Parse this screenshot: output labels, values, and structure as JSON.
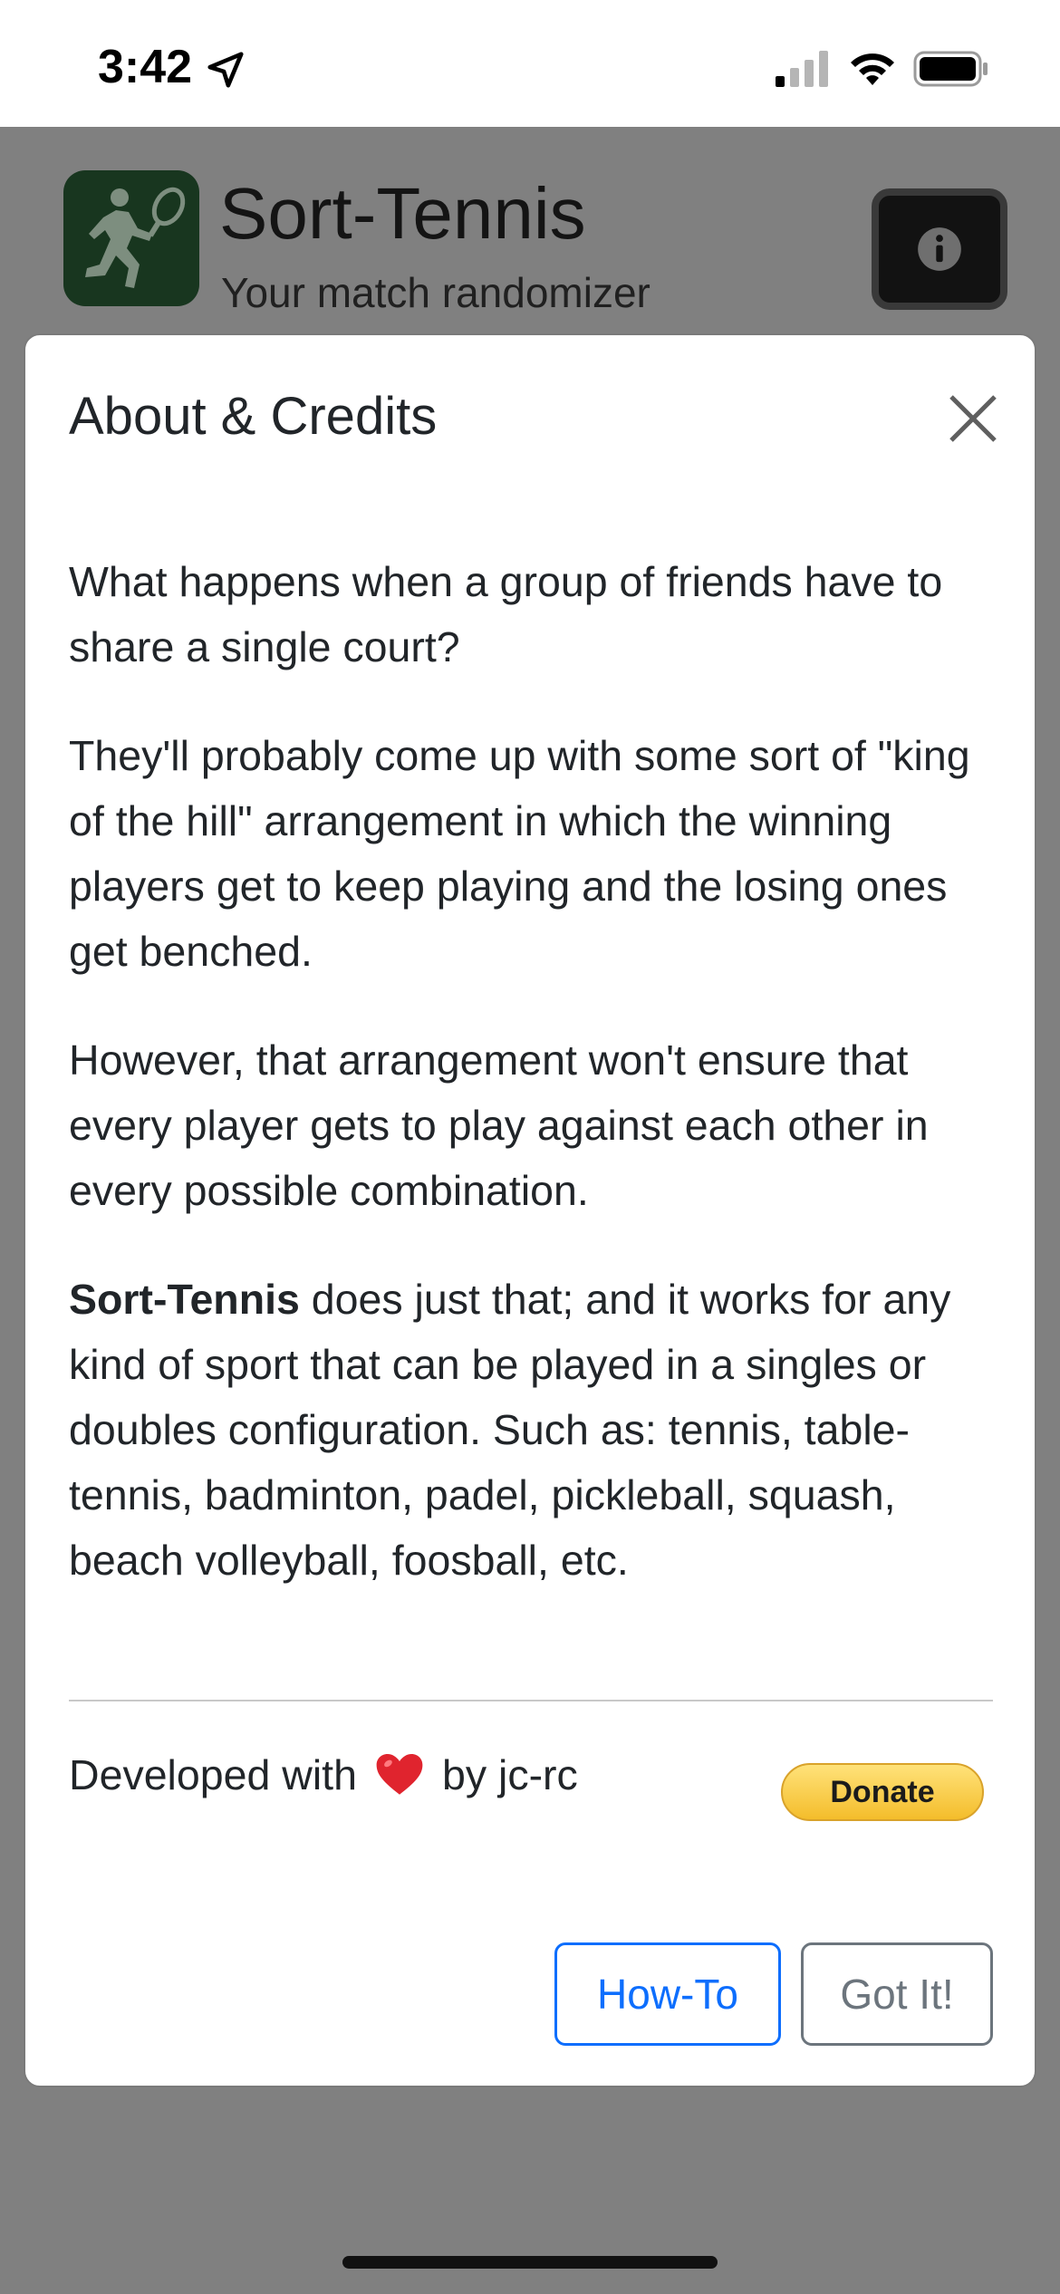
{
  "status_bar": {
    "time": "3:42",
    "icons": [
      "location-arrow-icon",
      "signal-icon",
      "wifi-icon",
      "battery-icon"
    ]
  },
  "app": {
    "title": "Sort-Tennis",
    "subtitle": "Your match randomizer",
    "logo_icon": "tennis-player-icon",
    "info_icon": "info-circle-icon",
    "logo_color": "#18361f"
  },
  "modal": {
    "title": "About & Credits",
    "close_icon": "close-icon",
    "paragraphs": {
      "p1": "What happens when a group of friends have to share a single court?",
      "p2": "They'll probably come up with some sort of \"king of the hill\" arrangement in which the winning players get to keep playing and the losing ones get benched.",
      "p3": "However, that arrangement won't ensure that every player gets to play against each other in every possible combination.",
      "p4_bold": "Sort-Tennis",
      "p4_rest": " does just that; and it works for any kind of sport that can be played in a singles or doubles configuration. Such as: tennis, table-tennis, badminton, padel, pickleball, squash, beach volleyball, foosball, etc."
    },
    "credits": {
      "prefix": "Developed with",
      "heart_icon": "heart-icon",
      "suffix": "by jc-rc"
    },
    "donate_label": "Donate",
    "howto_label": "How-To",
    "gotit_label": "Got It!"
  },
  "colors": {
    "primary": "#0d6efd",
    "secondary": "#6c757d",
    "donate": "#f4bd2b",
    "overlay": "#808080"
  }
}
